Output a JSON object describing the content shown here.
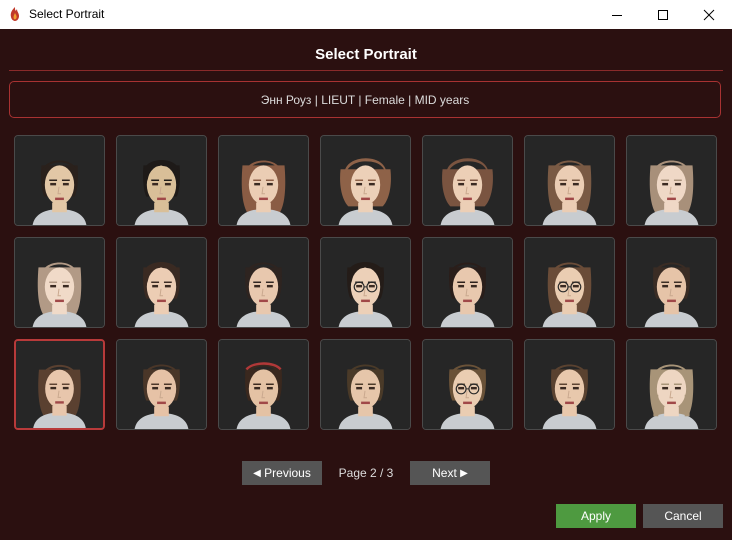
{
  "window": {
    "title": "Select Portrait",
    "app_icon": "flame-icon",
    "controls": [
      "minimize-icon",
      "maximize-icon",
      "close-icon"
    ]
  },
  "dialog": {
    "heading": "Select Portrait",
    "character_info": "Энн Роуз | LIEUT | Female | MID years"
  },
  "portraits": {
    "columns": 7,
    "rows": 3,
    "selected_index": 14,
    "items": [
      {
        "hair": "#2a211c",
        "skin": "#e2c7a6",
        "style": "short",
        "glasses": false
      },
      {
        "hair": "#1e1a18",
        "skin": "#d9bf98",
        "style": "bangs",
        "glasses": false
      },
      {
        "hair": "#8a5c44",
        "skin": "#ebcdb4",
        "style": "long",
        "glasses": false
      },
      {
        "hair": "#8e6248",
        "skin": "#ecd0b8",
        "style": "curly",
        "glasses": false
      },
      {
        "hair": "#7a5440",
        "skin": "#eccfb6",
        "style": "curly",
        "glasses": false
      },
      {
        "hair": "#7a5a44",
        "skin": "#ebcdb4",
        "style": "long",
        "glasses": false
      },
      {
        "hair": "#a8907a",
        "skin": "#efd8c6",
        "style": "long",
        "glasses": false
      },
      {
        "hair": "#b29a86",
        "skin": "#f0dac8",
        "style": "long",
        "glasses": false
      },
      {
        "hair": "#3a2a22",
        "skin": "#eccdb4",
        "style": "bangs",
        "glasses": false
      },
      {
        "hair": "#2e2420",
        "skin": "#e8c8ae",
        "style": "short",
        "glasses": false
      },
      {
        "hair": "#241c18",
        "skin": "#ecd0b8",
        "style": "bangs",
        "glasses": true
      },
      {
        "hair": "#2a1e1a",
        "skin": "#e8c8ae",
        "style": "short",
        "glasses": false
      },
      {
        "hair": "#6a4c38",
        "skin": "#eacdb2",
        "style": "long",
        "glasses": true
      },
      {
        "hair": "#3a2c24",
        "skin": "#e6c4a8",
        "style": "short",
        "glasses": false
      },
      {
        "hair": "#5a4030",
        "skin": "#e8c6ac",
        "style": "long",
        "glasses": false
      },
      {
        "hair": "#4a3628",
        "skin": "#e6c2a6",
        "style": "short",
        "glasses": false
      },
      {
        "hair": "#3a281e",
        "skin": "#e4c2a4",
        "style": "headband",
        "glasses": false
      },
      {
        "hair": "#4a3a28",
        "skin": "#e6c6aa",
        "style": "short",
        "glasses": false
      },
      {
        "hair": "#6a5238",
        "skin": "#eacdb2",
        "style": "short",
        "glasses": true
      },
      {
        "hair": "#5a4230",
        "skin": "#e8c8ac",
        "style": "short",
        "glasses": false
      },
      {
        "hair": "#a89478",
        "skin": "#eed6c2",
        "style": "braids",
        "glasses": false
      }
    ]
  },
  "pagination": {
    "prev_label": "Previous",
    "prev_icon": "triangle-left-icon",
    "page_text": "Page 2 / 3",
    "next_label": "Next",
    "next_icon": "triangle-right-icon"
  },
  "actions": {
    "apply_label": "Apply",
    "cancel_label": "Cancel"
  },
  "colors": {
    "background": "#2b1010",
    "accent": "#a83232",
    "apply": "#4e9a40",
    "button": "#555555"
  }
}
